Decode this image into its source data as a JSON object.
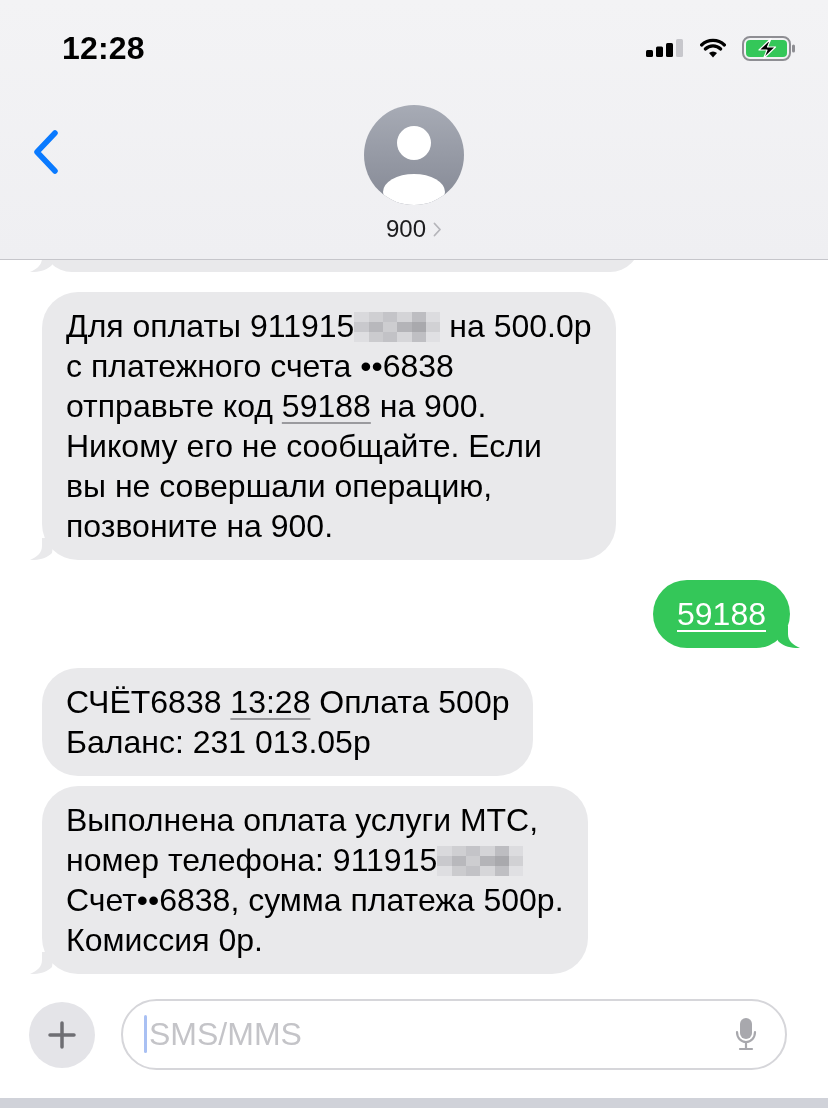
{
  "status_bar": {
    "time": "12:28"
  },
  "header": {
    "contact_name": "900"
  },
  "thread": {
    "clipped_bubble_above": true,
    "messages": [
      {
        "kind": "incoming",
        "tail": true,
        "segments": [
          {
            "kind": "text",
            "text": "Для оплаты 911915"
          },
          {
            "kind": "redacted"
          },
          {
            "kind": "text",
            "text": " на 500.0р\nс платежного счета ••6838\nотправьте код "
          },
          {
            "kind": "link",
            "text": "59188"
          },
          {
            "kind": "text",
            "text": " на 900.\nНикому его не сообщайте. Если\nвы не совершали операцию,\nпозвоните на 900."
          }
        ]
      },
      {
        "kind": "outgoing",
        "tail": true,
        "segments": [
          {
            "kind": "link",
            "text": "59188"
          }
        ]
      },
      {
        "kind": "incoming",
        "tail": false,
        "segments": [
          {
            "kind": "text",
            "text": "СЧЁТ6838 "
          },
          {
            "kind": "link",
            "text": "13:28"
          },
          {
            "kind": "text",
            "text": " Оплата 500р\nБаланс: 231 013.05р"
          }
        ]
      },
      {
        "kind": "incoming",
        "tail": true,
        "segments": [
          {
            "kind": "text",
            "text": "Выполнена оплата услуги МТС,\nномер телефона: 911915"
          },
          {
            "kind": "redacted"
          },
          {
            "kind": "text",
            "text": "\nСчет••6838, сумма платежа 500р.\nКомиссия 0р."
          }
        ]
      }
    ]
  },
  "composer": {
    "placeholder": "SMS/MMS"
  }
}
